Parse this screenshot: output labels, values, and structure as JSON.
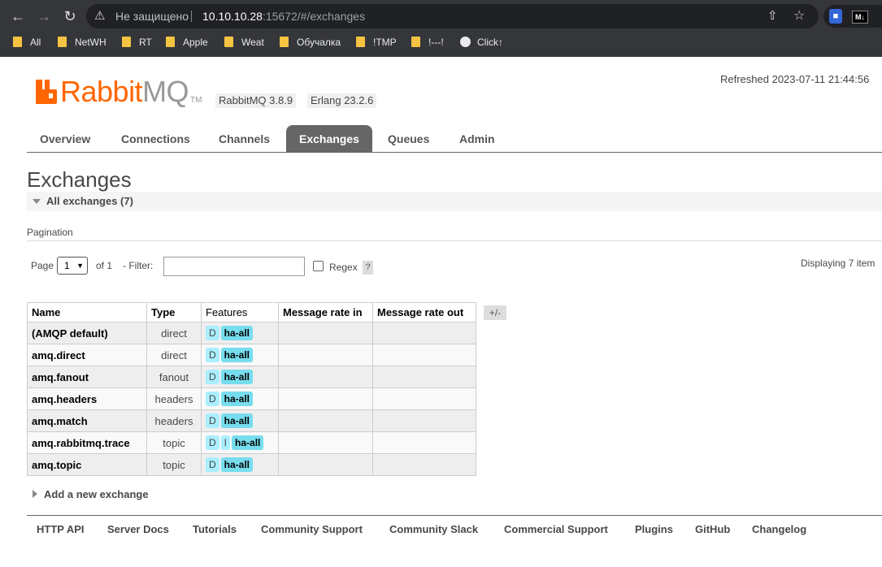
{
  "browser": {
    "security_label": "Не защищено",
    "url_host": "10.10.10.28",
    "url_rest": ":15672/#/exchanges",
    "bookmarks": [
      "All",
      "NetWH",
      "RT",
      "Apple",
      "Weat",
      "Обучалка",
      "!TMP",
      "!---!",
      "Click↑"
    ]
  },
  "header": {
    "logo_rabbit": "Rabbit",
    "logo_mq": "MQ",
    "logo_tm": "TM",
    "rabbitmq_version": "RabbitMQ 3.8.9",
    "erlang_version": "Erlang 23.2.6",
    "refreshed": "Refreshed 2023-07-11 21:44:56"
  },
  "tabs": [
    "Overview",
    "Connections",
    "Channels",
    "Exchanges",
    "Queues",
    "Admin"
  ],
  "active_tab": "Exchanges",
  "page_title": "Exchanges",
  "section_title": "All exchanges (7)",
  "pagination": {
    "label": "Pagination",
    "page_label": "Page",
    "page_value": "1",
    "of_label": "of 1",
    "filter_label": "- Filter:",
    "filter_value": "",
    "regex_label": "Regex",
    "help": "?",
    "displaying": "Displaying 7 item"
  },
  "table": {
    "headers": [
      "Name",
      "Type",
      "Features",
      "Message rate in",
      "Message rate out"
    ],
    "toggle": "+/-",
    "rows": [
      {
        "name": "(AMQP default)",
        "type": "direct",
        "features": [
          "D"
        ],
        "policy": "ha-all"
      },
      {
        "name": "amq.direct",
        "type": "direct",
        "features": [
          "D"
        ],
        "policy": "ha-all"
      },
      {
        "name": "amq.fanout",
        "type": "fanout",
        "features": [
          "D"
        ],
        "policy": "ha-all"
      },
      {
        "name": "amq.headers",
        "type": "headers",
        "features": [
          "D"
        ],
        "policy": "ha-all"
      },
      {
        "name": "amq.match",
        "type": "headers",
        "features": [
          "D"
        ],
        "policy": "ha-all"
      },
      {
        "name": "amq.rabbitmq.trace",
        "type": "topic",
        "features": [
          "D",
          "I"
        ],
        "policy": "ha-all"
      },
      {
        "name": "amq.topic",
        "type": "topic",
        "features": [
          "D"
        ],
        "policy": "ha-all"
      }
    ]
  },
  "add_new": "Add a new exchange",
  "footer": [
    "HTTP API",
    "Server Docs",
    "Tutorials",
    "Community Support",
    "Community Slack",
    "Commercial Support",
    "Plugins",
    "GitHub",
    "Changelog"
  ],
  "colors": {
    "brand": "#ff6600",
    "tab_active": "#666666",
    "badge": "#aaeeff",
    "policy_badge": "#77ddee"
  }
}
